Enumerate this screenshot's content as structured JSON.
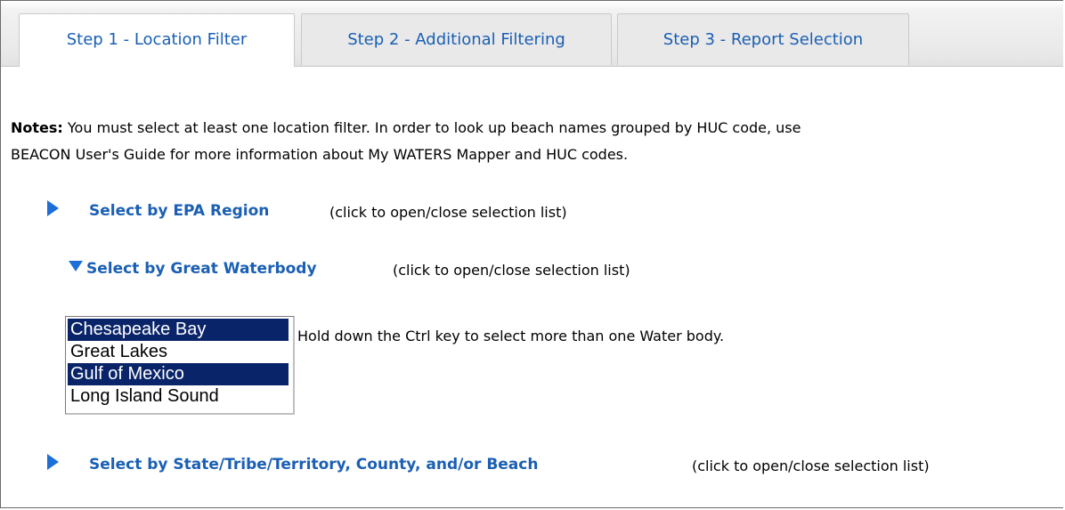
{
  "tabs": [
    {
      "label": "Step 1 - Location Filter",
      "active": true
    },
    {
      "label": "Step 2 - Additional Filtering",
      "active": false
    },
    {
      "label": "Step 3 - Report Selection",
      "active": false
    }
  ],
  "notes": {
    "label": "Notes:",
    "line1": " You must select at least one location filter. In order to look up beach names grouped by HUC code, use",
    "line2": "BEACON User's Guide for more information about My WATERS Mapper and HUC codes."
  },
  "filters": {
    "epa_region": {
      "label": "Select by EPA Region",
      "hint": "(click to open/close selection list)",
      "expanded": false,
      "icon": "triangle-right-icon"
    },
    "great_waterbody": {
      "label": "Select by Great Waterbody",
      "hint": "(click to open/close selection list)",
      "expanded": true,
      "icon": "triangle-down-icon",
      "options": [
        {
          "label": "Chesapeake Bay",
          "selected": true
        },
        {
          "label": "Great Lakes",
          "selected": false
        },
        {
          "label": "Gulf of Mexico",
          "selected": true
        },
        {
          "label": "Long Island Sound",
          "selected": false
        }
      ],
      "instruction": "Hold down the Ctrl key to select more than one Water body."
    },
    "state_tribe": {
      "label": "Select by State/Tribe/Territory, County, and/or Beach",
      "hint": "(click to open/close selection list)",
      "expanded": false,
      "icon": "triangle-right-icon"
    }
  },
  "colors": {
    "link": "#1a5fb4",
    "arrow": "#1d6fd8",
    "selection": "#0a246a"
  }
}
